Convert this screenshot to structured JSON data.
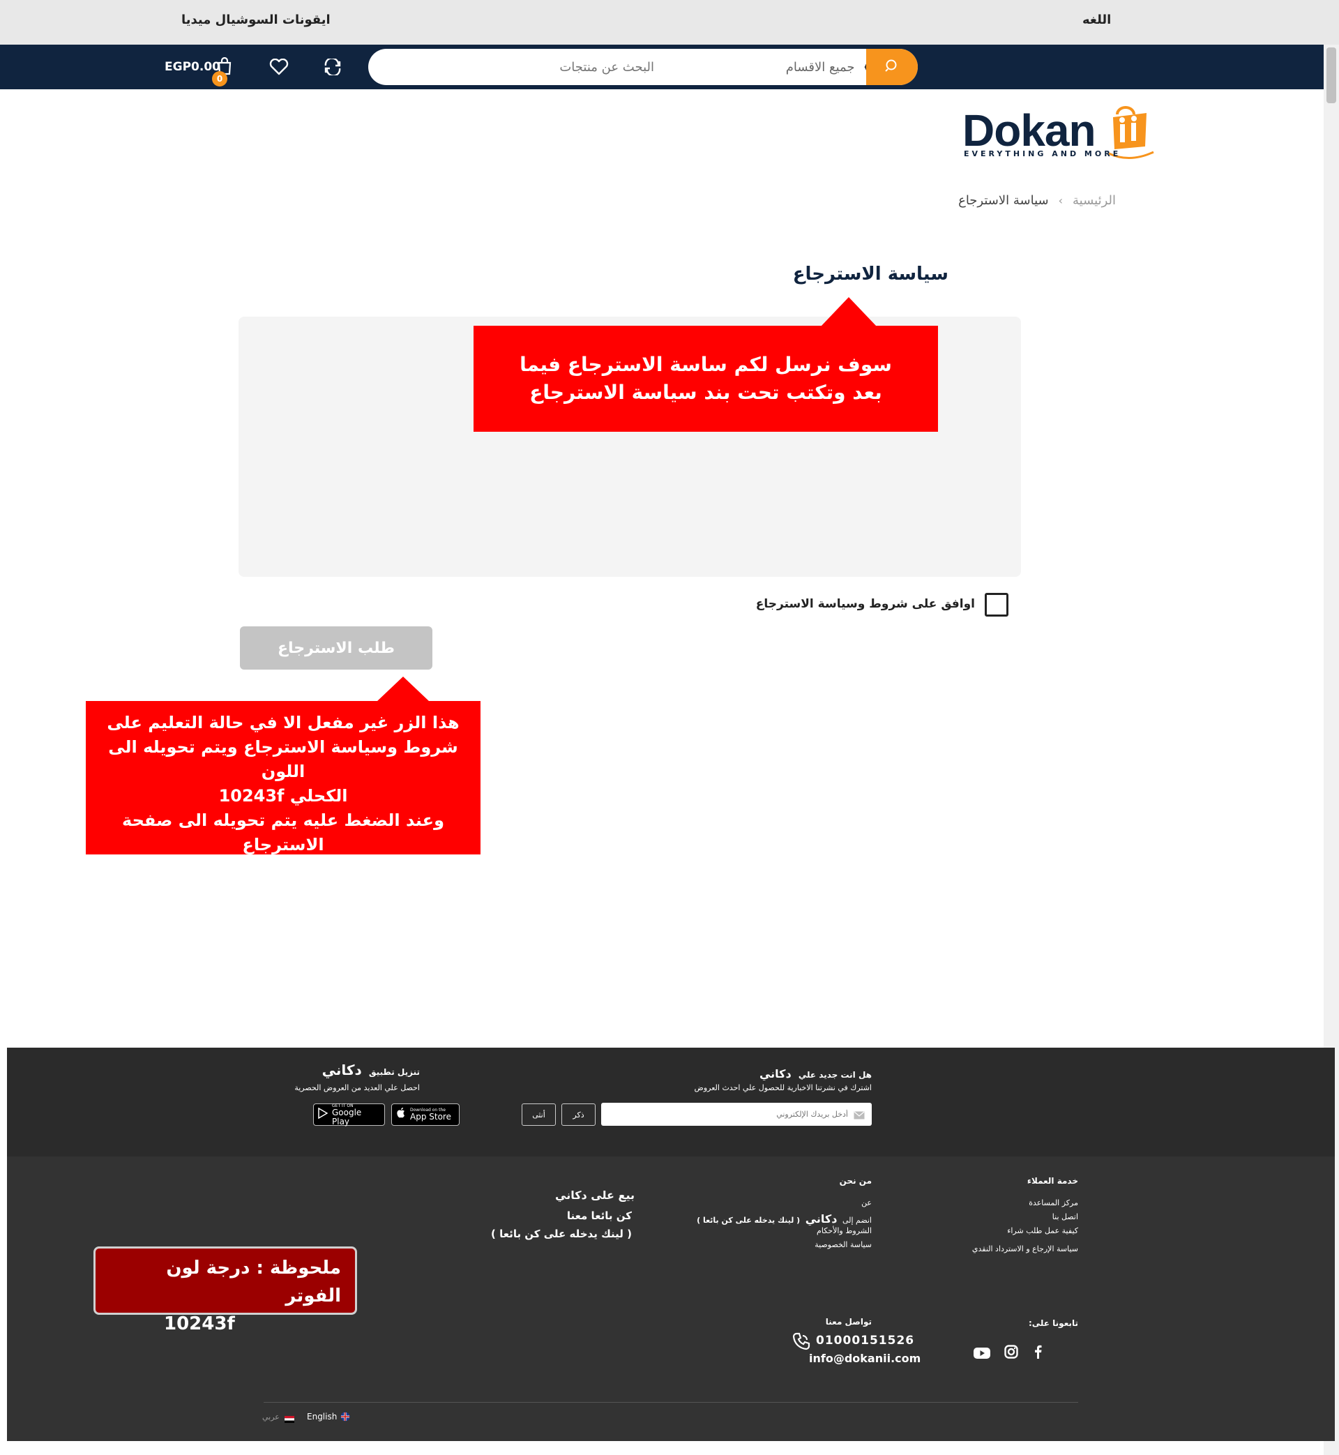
{
  "topbar": {
    "language_label": "اللغه",
    "social_label": "ايقونات السوشيال ميديا"
  },
  "nav": {
    "search_placeholder": "البحث عن منتجات",
    "category_select": "جميع الاقسام",
    "cart_total": "EGP0.00",
    "cart_count": "0"
  },
  "logo": {
    "text": "Dokan",
    "tagline": "EVERYTHING AND MORE"
  },
  "breadcrumb": {
    "home": "الرئيسية",
    "separator": "›",
    "current": "سياسة الاسترجاع"
  },
  "page": {
    "title": "سياسة الاسترجاع",
    "callout_1": "سوف نرسل لكم ساسة الاسترجاع فيما بعد وتكتب تحت بند سياسة الاسترجاع",
    "agree_label": "اوافق على شروط وسياسة الاسترجاع",
    "submit_label": "طلب الاسترجاع",
    "callout_2_lines": [
      "هذا الزر غير مفعل الا في حالة التعليم على",
      "شروط وسياسة الاسترجاع ويتم تحويله الى اللون",
      "الكحلي  10243f",
      "وعند الضغط عليه يتم تحويله الى صفحة",
      "الاسترجاع"
    ]
  },
  "footer": {
    "newsletter": {
      "heading": "هل انت جديد علي",
      "brand": "دكاني",
      "subtitle": "اشترك في نشرتنا الاخبارية للحصول علي احدث العروض",
      "placeholder": "أدخل بريدك الإلكتروني",
      "male_btn": "ذكر",
      "female_btn": "أنثى"
    },
    "app": {
      "heading": "تنزيل تطبيق",
      "brand": "دكاني",
      "subtitle": "احصل علي العديد من العروض الحصرية",
      "google_small": "GET IT ON",
      "google_big": "Google Play",
      "apple_small": "Download on the",
      "apple_big": "App Store"
    },
    "customer_service": {
      "heading": "خدمة العملاء",
      "links": [
        "مركز المساعدة",
        "اتصل بنا",
        "كيفية عمل طلب شراء",
        "سياسة الإرجاع و الاسترداد النقدي"
      ]
    },
    "about": {
      "heading": "من نحن",
      "links": [
        "عن",
        "الشروط والأحكام",
        "سياسة الخصوصية"
      ],
      "join_prefix": "انضم إلى",
      "join_brand": "دكاني",
      "join_note": "( لينك يدخله على كن بائعا )"
    },
    "sell": {
      "title": "بيع على دكاني",
      "subtitle": "كن بائعا معنا",
      "note": "( لينك يدخله على كن بائعا )"
    },
    "note_box_line1": "ملحوظة : درجة لون الفوتر",
    "note_box_line2": "10243f",
    "follow_heading": "تابعونا على:",
    "contact": {
      "heading": "تواصل معنا",
      "phone": "01000151526",
      "email": "info@dokanii.com"
    },
    "languages": {
      "english": "English",
      "arabic": "عربي"
    }
  },
  "colors": {
    "navy": "#10243f",
    "orange": "#f7941d",
    "callout_red": "#ff0000"
  }
}
